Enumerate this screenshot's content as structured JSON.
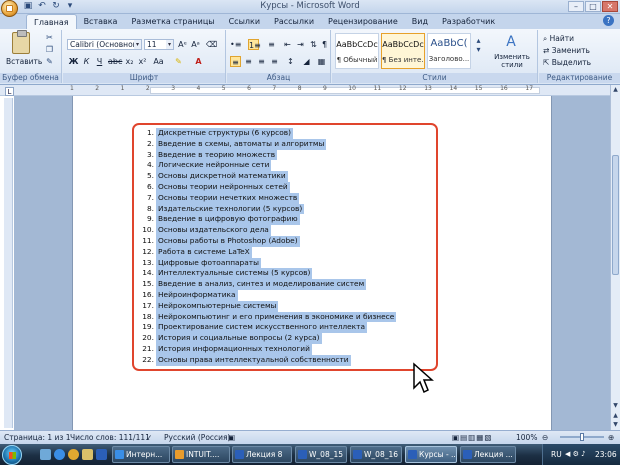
{
  "window": {
    "title": "Курсы - Microsoft Word"
  },
  "qat": [
    "save-icon",
    "undo-icon",
    "redo-icon",
    "customize-icon"
  ],
  "tabs": [
    "Главная",
    "Вставка",
    "Разметка страницы",
    "Ссылки",
    "Рассылки",
    "Рецензирование",
    "Вид",
    "Разработчик"
  ],
  "ribbon": {
    "clipboard": {
      "paste_label": "Вставить",
      "group_label": "Буфер обмена"
    },
    "font": {
      "font_name": "Calibri (Основной те",
      "font_size": "11",
      "group_label": "Шрифт",
      "bold": "Ж",
      "italic": "К",
      "underline": "Ч"
    },
    "paragraph": {
      "group_label": "Абзац"
    },
    "styles": {
      "group_label": "Стили",
      "items": [
        {
          "preview": "AaBbCcDc",
          "name": "¶ Обычный"
        },
        {
          "preview": "AaBbCcDc",
          "name": "¶ Без инте..."
        },
        {
          "preview": "AaBbC(",
          "name": "Заголово..."
        }
      ],
      "change_styles": "Изменить стили"
    },
    "editing": {
      "group_label": "Редактирование",
      "find": "Найти",
      "replace": "Заменить",
      "select": "Выделить"
    }
  },
  "ruler_numbers": [
    "1",
    "2",
    "1",
    "2",
    "3",
    "4",
    "5",
    "6",
    "7",
    "8",
    "9",
    "10",
    "11",
    "12",
    "13",
    "14",
    "15",
    "16",
    "17"
  ],
  "document": {
    "items": [
      {
        "n": "1.",
        "t": "Дискретные структуры (6 курсов)"
      },
      {
        "n": "2.",
        "t": "Введение в схемы, автоматы и алгоритмы"
      },
      {
        "n": "3.",
        "t": "Введение в теорию множеств"
      },
      {
        "n": "4.",
        "t": "Логические нейронные сети"
      },
      {
        "n": "5.",
        "t": "Основы дискретной математики"
      },
      {
        "n": "6.",
        "t": "Основы теории нейронных сетей"
      },
      {
        "n": "7.",
        "t": "Основы теории нечетких множеств"
      },
      {
        "n": "8.",
        "t": "Издательские технологии (5 курсов)"
      },
      {
        "n": "9.",
        "t": "Введение в цифровую фотографию"
      },
      {
        "n": "10.",
        "t": "Основы издательского дела"
      },
      {
        "n": "11.",
        "t": "Основы работы в Photoshop (Adobe)"
      },
      {
        "n": "12.",
        "t": "Работа в системе LaTeX"
      },
      {
        "n": "13.",
        "t": "Цифровые фотоаппараты"
      },
      {
        "n": "14.",
        "t": "Интеллектуальные системы (5 курсов)"
      },
      {
        "n": "15.",
        "t": "Введение в анализ, синтез и моделирование систем"
      },
      {
        "n": "16.",
        "t": "Нейроинформатика"
      },
      {
        "n": "17.",
        "t": "Нейрокомпьютерные системы"
      },
      {
        "n": "18.",
        "t": "Нейрокомпьютинг и его применения в экономике и бизнесе"
      },
      {
        "n": "19.",
        "t": "Проектирование систем искусственного интеллекта"
      },
      {
        "n": "20.",
        "t": "История и социальные вопросы (2 курса)"
      },
      {
        "n": "21.",
        "t": "История информационных технологий"
      },
      {
        "n": "22.",
        "t": "Основы права интеллектуальной собственности"
      }
    ]
  },
  "status": {
    "page": "Страница: 1 из 1",
    "words": "Число слов: 111/111",
    "language": "Русский (Россия)",
    "zoom": "100%"
  },
  "taskbar": {
    "buttons": [
      {
        "label": "Интерн...",
        "color": "#3a8ee6"
      },
      {
        "label": "INTUIT....",
        "color": "#e89b2c"
      },
      {
        "label": "Лекция 8",
        "color": "#2b5fb8"
      },
      {
        "label": "W_08_15",
        "color": "#2b5fb8"
      },
      {
        "label": "W_08_16",
        "color": "#2b5fb8"
      },
      {
        "label": "Курсы - ...",
        "color": "#2b5fb8"
      },
      {
        "label": "Лекция ...",
        "color": "#2b5fb8"
      }
    ],
    "lang": "RU",
    "time": "23:06"
  }
}
